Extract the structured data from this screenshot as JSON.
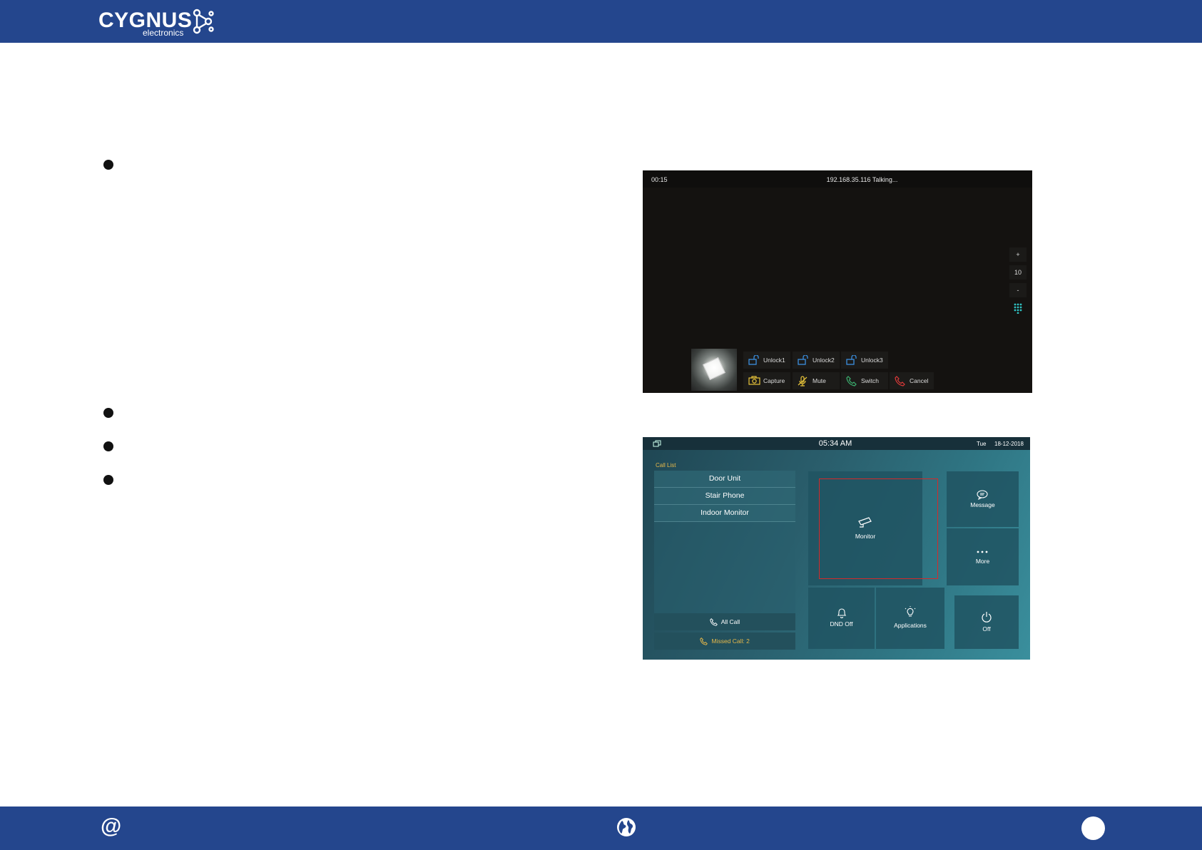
{
  "header": {
    "brand": "CYGNUS",
    "subbrand": "electronics"
  },
  "screen_talking": {
    "timer": "00:15",
    "status": "192.168.35.116  Talking...",
    "side": {
      "plus": "+",
      "volume": "10",
      "minus": "-"
    },
    "buttons": [
      {
        "label": "Unlock1",
        "icon": "unlock-icon"
      },
      {
        "label": "Unlock2",
        "icon": "unlock-icon"
      },
      {
        "label": "Unlock3",
        "icon": "unlock-icon"
      },
      {
        "label": "Capture",
        "icon": "camera-icon"
      },
      {
        "label": "Mute",
        "icon": "mic-mute-icon"
      },
      {
        "label": "Switch",
        "icon": "phone-icon"
      },
      {
        "label": "Cancel",
        "icon": "phone-hangup-icon"
      }
    ],
    "colors": {
      "unlock": "#3b8fe0",
      "capture": "#e8c43a",
      "switch": "#3cb371",
      "cancel": "#e03a3a"
    }
  },
  "screen_home": {
    "time": "05:34 AM",
    "day": "Tue",
    "date": "18-12-2018",
    "call_list_title": "Call List",
    "call_list": [
      "Door Unit",
      "Stair Phone",
      "Indoor Monitor"
    ],
    "all_call": "All Call",
    "missed_call": "Missed Call: 2",
    "tiles": {
      "monitor": "Monitor",
      "message": "Message",
      "more": "More",
      "dnd": "DND Off",
      "applications": "Applications",
      "off": "Off"
    },
    "colors": {
      "missed": "#e8b94a",
      "highlight": "#d42a2a"
    }
  },
  "footer": {
    "at_symbol": "@"
  }
}
